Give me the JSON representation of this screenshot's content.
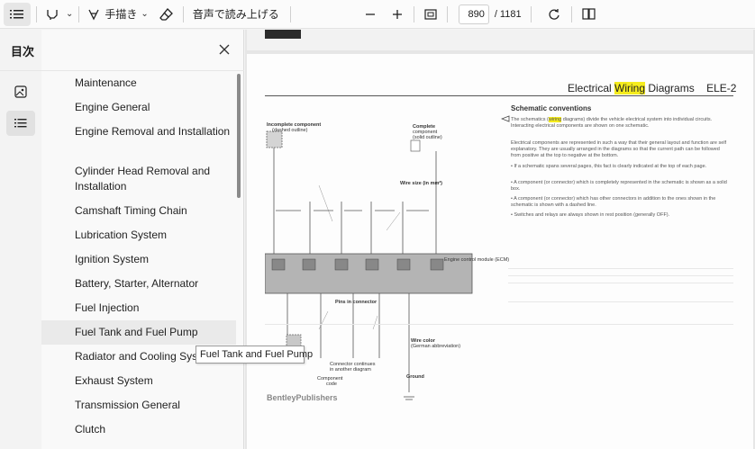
{
  "toolbar": {
    "draw_label": "手描き",
    "read_aloud_label": "音声で読み上げる",
    "page_current": "890",
    "page_total": "/ 1181"
  },
  "panel": {
    "title": "目次",
    "items": [
      {
        "label": "Maintenance"
      },
      {
        "label": "Engine General"
      },
      {
        "label": "Engine Removal and Installation"
      },
      {
        "label": "Cylinder Head Removal and Installation"
      },
      {
        "label": "Camshaft Timing Chain"
      },
      {
        "label": "Lubrication System"
      },
      {
        "label": "Ignition System"
      },
      {
        "label": "Battery, Starter, Alternator"
      },
      {
        "label": "Fuel Injection"
      },
      {
        "label": "Fuel Tank and Fuel Pump"
      },
      {
        "label": "Radiator and Cooling System"
      },
      {
        "label": "Exhaust System"
      },
      {
        "label": "Transmission General"
      },
      {
        "label": "Clutch"
      }
    ],
    "tooltip": "Fuel Tank and Fuel Pump"
  },
  "document": {
    "header_prefix": "Electrical ",
    "header_highlight": "Wiring",
    "header_suffix": " Diagrams",
    "header_code": "ELE-2",
    "section_title": "Schematic conventions",
    "para1_a": "The schematics (",
    "para1_hl": "wiring",
    "para1_b": " diagrams) divide the vehicle electrical system into individual circuits. Interacting electrical components are shown on one schematic.",
    "para2": "Electrical components are represented in such a way that their general layout and function are self explanatory. They are usually arranged in the diagrams so that the current path can be followed from positive at the top to negative at the bottom.",
    "bullets": [
      "• If a schematic spans several pages, this fact is clearly indicated at the top of each page.",
      "• A component (or connector) which is completely represented in the schematic is shown as a solid box.",
      "• A component (or connector) which has other connectors in addition to the ones shown in the schematic is shown with a dashed line.",
      "• Switches and relays are always shown in rest position (generally OFF)."
    ],
    "diagram_labels": {
      "incomplete": "Incomplete component",
      "incomplete_sub": "(dashed outline)",
      "complete": "Complete",
      "complete_sub1": "component",
      "complete_sub2": "(solid outline)",
      "wire_size": "Wire size (in mm²)",
      "pins": "Pins in connector",
      "wire_color": "Wire color",
      "wire_color_sub": "(German abbreviation)",
      "connector": "Connector continues",
      "connector_sub": "in another diagram",
      "component_code": "Component",
      "component_code_sub": "code",
      "ground": "Ground",
      "ecm": "Engine control module (ECM)"
    },
    "publisher": "BentleyPublishers"
  }
}
